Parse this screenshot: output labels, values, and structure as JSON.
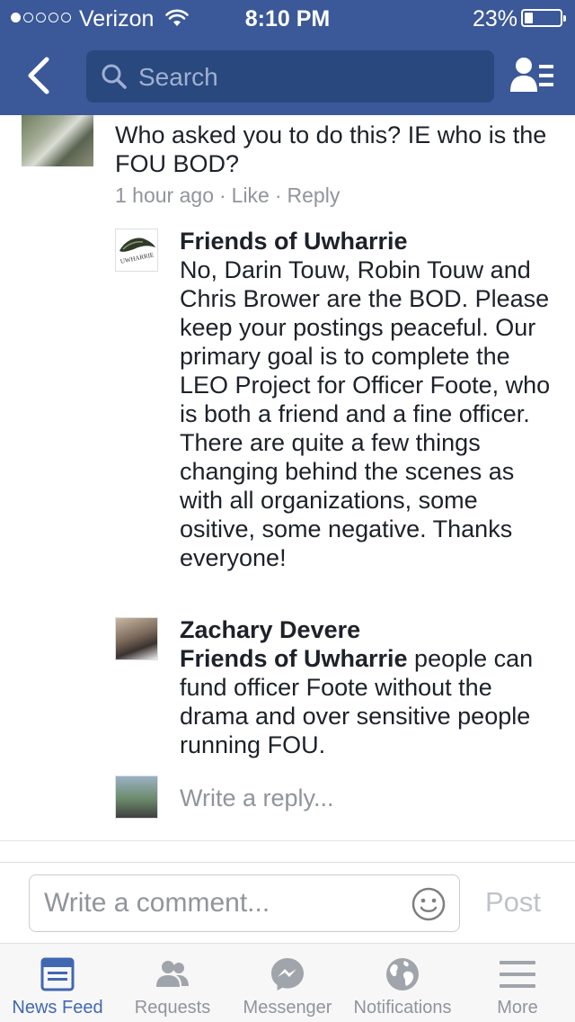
{
  "status_bar": {
    "carrier": "Verizon",
    "time": "8:10 PM",
    "battery": "23%",
    "battery_level": 0.23
  },
  "nav": {
    "back_icon": "chevron-left-icon",
    "search_placeholder": "Search",
    "friends_icon": "friend-list-icon"
  },
  "thread": {
    "main_comment": {
      "text": "Who asked you to do this?  IE who is the FOU BOD?",
      "time": "1 hour ago",
      "like": "Like",
      "reply": "Reply",
      "separator": "·"
    },
    "replies": [
      {
        "name": "Friends of Uwharrie",
        "avatar_text": "UWHARRIE",
        "text": "No, Darin Touw, Robin Touw and Chris Brower are the BOD. Please keep your postings peaceful. Our primary goal is to complete the LEO Project for Officer Foote, who is both a friend and a fine officer.  There are quite a few things changing behind the scenes as with all organizations, some ositive, some negative. Thanks everyone!"
      },
      {
        "name": "Zachary Devere",
        "mention": "Friends of Uwharrie",
        "text": " people can fund officer Foote without the drama and over sensitive people running FOU."
      }
    ],
    "write_reply_placeholder": "Write a reply..."
  },
  "composer": {
    "placeholder": "Write a comment...",
    "emoji_icon": "smiley-icon",
    "post_label": "Post"
  },
  "tabbar": {
    "tabs": [
      {
        "label": "News Feed",
        "icon": "news-feed-icon",
        "active": true
      },
      {
        "label": "Requests",
        "icon": "requests-icon",
        "active": false
      },
      {
        "label": "Messenger",
        "icon": "messenger-icon",
        "active": false
      },
      {
        "label": "Notifications",
        "icon": "globe-icon",
        "active": false
      },
      {
        "label": "More",
        "icon": "menu-icon",
        "active": false
      }
    ]
  },
  "colors": {
    "brand": "#3b5998",
    "active_tab": "#4267b2",
    "muted": "#90949c"
  }
}
